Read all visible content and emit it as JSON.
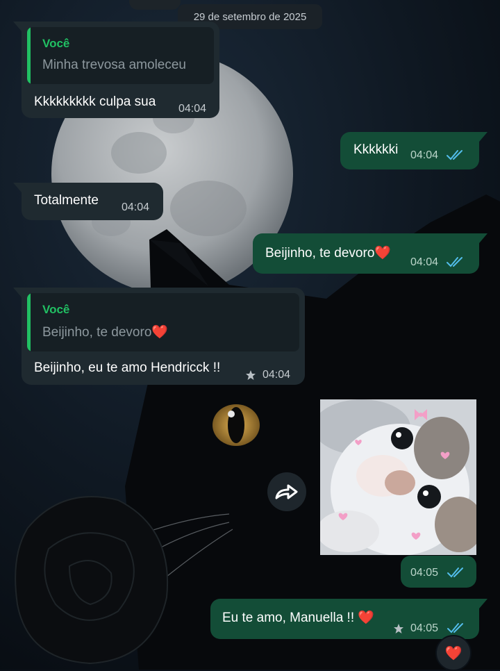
{
  "date_separator": "29 de setembro de 2025",
  "colors": {
    "incoming_bubble": "#1f2a30",
    "outgoing_bubble": "#134d37",
    "quote_accent": "#21c063",
    "read_ticks": "#53bdeb"
  },
  "messages": [
    {
      "direction": "incoming",
      "quote": {
        "author": "Você",
        "text": "Minha trevosa amoleceu"
      },
      "text": "Kkkkkkkkk culpa sua",
      "time": "04:04"
    },
    {
      "direction": "outgoing",
      "text": "Kkkkkki",
      "time": "04:04",
      "status": "read"
    },
    {
      "direction": "incoming",
      "text": "Totalmente",
      "time": "04:04"
    },
    {
      "direction": "outgoing",
      "text": "Beijinho, te devoro❤️",
      "time": "04:04",
      "status": "read"
    },
    {
      "direction": "incoming",
      "quote": {
        "author": "Você",
        "text": "Beijinho, te devoro❤️"
      },
      "text": "Beijinho, eu te amo Hendricck !!",
      "time": "04:04",
      "starred": true
    },
    {
      "direction": "outgoing",
      "type": "image",
      "image_icon": "kitten-photo",
      "time": "04:05",
      "status": "read"
    },
    {
      "direction": "outgoing",
      "text": "Eu te amo, Manuella !! ❤️",
      "time": "04:05",
      "status": "read",
      "starred": true,
      "reaction": "❤️"
    }
  ]
}
